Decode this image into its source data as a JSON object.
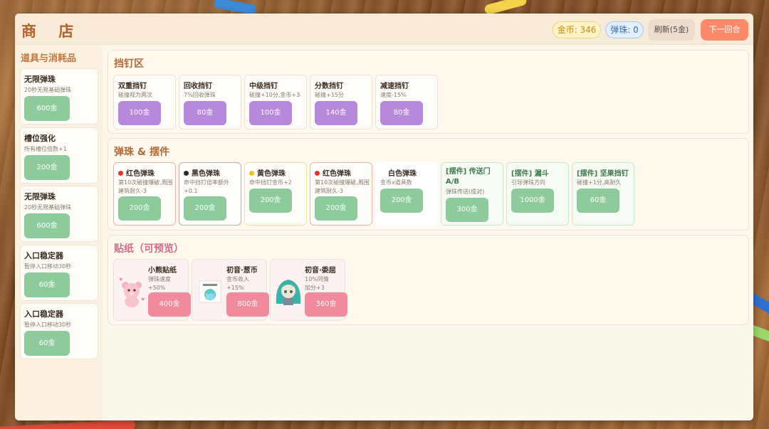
{
  "header": {
    "title": "商 店",
    "coins_label": "金币: 346",
    "balls_label": "弹珠: 0",
    "refresh_label": "刷新(5金)",
    "next_round_label": "下一回合"
  },
  "sidebar": {
    "title": "道具与消耗品",
    "items": [
      {
        "name": "无限弹珠",
        "desc": "20秒无限基础弹珠",
        "price": "600金"
      },
      {
        "name": "槽位强化",
        "desc": "所有槽位倍数+1",
        "price": "200金"
      },
      {
        "name": "无限弹珠",
        "desc": "20秒无限基础弹珠",
        "price": "600金"
      },
      {
        "name": "入口稳定器",
        "desc": "暂停入口移动30秒",
        "price": "60金"
      },
      {
        "name": "入口稳定器",
        "desc": "暂停入口移动30秒",
        "price": "60金"
      }
    ]
  },
  "pegs": {
    "title": "挡钉区",
    "items": [
      {
        "name": "双重挡钉",
        "desc": "碰撞视为两次",
        "price": "100金"
      },
      {
        "name": "回收挡钉",
        "desc": "7%回收弹珠",
        "price": "80金"
      },
      {
        "name": "中级挡钉",
        "desc": "碰撞+10分,金币+3",
        "price": "100金"
      },
      {
        "name": "分数挡钉",
        "desc": "碰撞+15分",
        "price": "140金"
      },
      {
        "name": "减速挡钉",
        "desc": "速度-15%",
        "price": "80金"
      }
    ]
  },
  "balls": {
    "title": "弹珠 & 摆件",
    "items": [
      {
        "name": "红色弹珠",
        "desc": "第10次碰撞爆破,周围建筑耐久-3",
        "price": "200金",
        "dot": "#e0352e",
        "border": "#f0b0a8"
      },
      {
        "name": "黑色弹珠",
        "desc": "命中挡钉倍率额外+0.1",
        "price": "200金",
        "dot": "#2a2a2a",
        "border": "#b0b0b0"
      },
      {
        "name": "黄色弹珠",
        "desc": "命中挡钉金币+2",
        "price": "200金",
        "dot": "#f2c21a",
        "border": "#f3e0a0"
      },
      {
        "name": "红色弹珠",
        "desc": "第10次碰撞爆破,周围建筑耐久-3",
        "price": "200金",
        "dot": "#e0352e",
        "border": "#f0b0a8"
      },
      {
        "name": "白色弹珠",
        "desc": "金币x道具数",
        "price": "200金",
        "dot": "#ffffff",
        "border": "#ffffff"
      },
      {
        "name": "[摆件] 传送门A/B",
        "desc": "弹珠传送(成对)",
        "price": "300金",
        "dot": "",
        "border": "#c8e8cc"
      },
      {
        "name": "[摆件] 漏斗",
        "desc": "引导弹珠方向",
        "price": "1000金",
        "dot": "",
        "border": "#c8e8cc"
      },
      {
        "name": "[摆件] 坚果挡钉",
        "desc": "碰撞+1分,高耐久",
        "price": "60金",
        "dot": "",
        "border": "#c8e8cc"
      }
    ]
  },
  "stickers": {
    "title": "贴纸（可预览）",
    "items": [
      {
        "name": "小熊贴纸",
        "desc": "弹珠速度+50%",
        "price": "400金"
      },
      {
        "name": "初音·葱币",
        "desc": "金币收入+15%",
        "price": "800金"
      },
      {
        "name": "初音·委屈",
        "desc": "10%同情加分+3",
        "price": "360金"
      }
    ]
  },
  "colors": {
    "accent": "#b2612e",
    "buy_green": "#8ecb9c",
    "buy_purple": "#b689db",
    "buy_pink": "#f08a9c",
    "next_round": "#fb8a6a"
  }
}
